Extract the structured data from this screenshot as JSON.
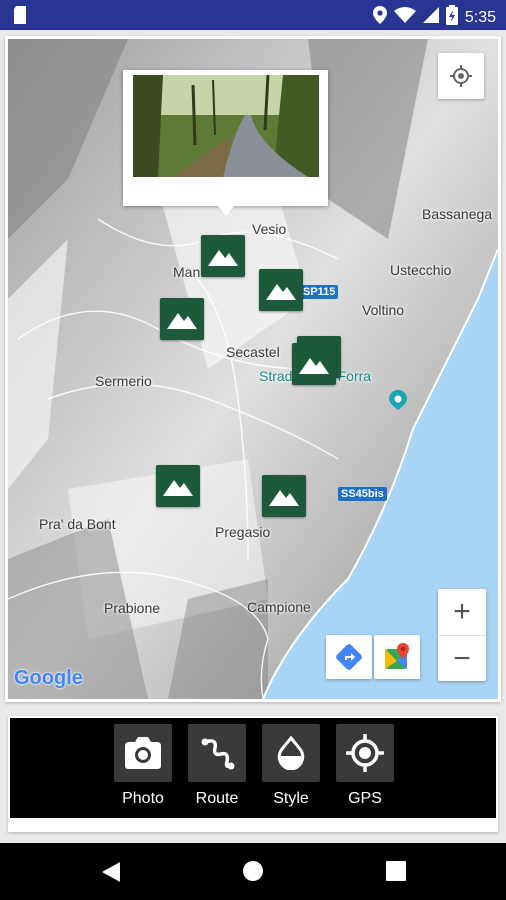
{
  "status_bar": {
    "time": "5:35",
    "icons": [
      "sd-card-icon",
      "location-icon",
      "wifi-icon",
      "signal-icon",
      "battery-icon"
    ]
  },
  "map": {
    "places": [
      "Vesio",
      "Bassanega",
      "Mandes",
      "Ustecchio",
      "Voltino",
      "Secastel",
      "Strada della Forra",
      "Sermerio",
      "Pra' da Bont",
      "Pregasio",
      "Prabione",
      "Campione"
    ],
    "road_shields": [
      "SP115",
      "SS45bis"
    ],
    "attribution": "Google",
    "zoom_in": "+",
    "zoom_out": "−"
  },
  "toolbar": [
    {
      "label": "Photo",
      "icon": "camera-icon"
    },
    {
      "label": "Route",
      "icon": "route-icon"
    },
    {
      "label": "Style",
      "icon": "drop-icon"
    },
    {
      "label": "GPS",
      "icon": "gps-icon"
    }
  ],
  "colors": {
    "status_bar": "#283593",
    "marker": "#1d5a3c",
    "water": "#a8d4f5",
    "toolbar": "#000000"
  }
}
